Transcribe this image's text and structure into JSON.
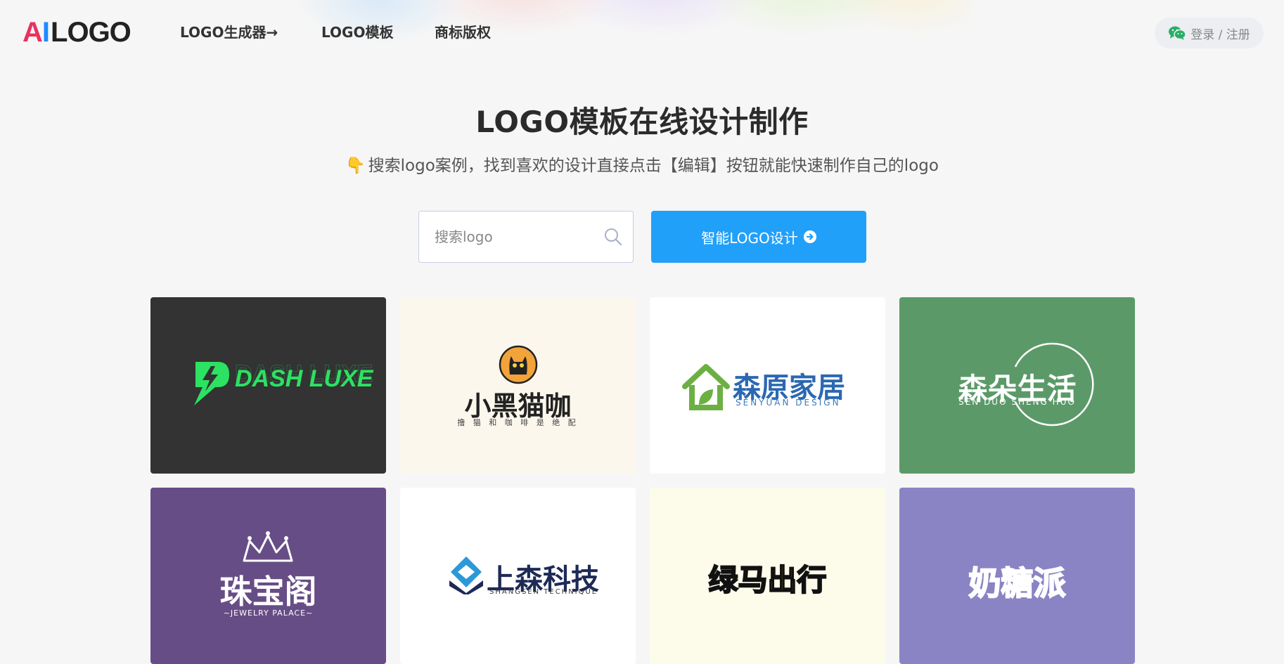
{
  "header": {
    "logo_a": "A",
    "logo_i": "I",
    "logo_rest": "LOGO",
    "nav": [
      {
        "label": "LOGO生成器→"
      },
      {
        "label": "LOGO模板"
      },
      {
        "label": "商标版权"
      }
    ],
    "login_label": "登录 / 注册"
  },
  "hero": {
    "title": "LOGO模板在线设计制作",
    "hand_icon": "👇",
    "subtitle": "搜索logo案例，找到喜欢的设计直接点击【编辑】按钮就能快速制作自己的logo"
  },
  "search": {
    "placeholder": "搜索logo",
    "value": ""
  },
  "design_button": {
    "label": "智能LOGO设计"
  },
  "cards": [
    {
      "name": "DASH LUXE",
      "bg": "#333333"
    },
    {
      "name": "小黑猫咖",
      "slogan": "撸 猫 和 咖 啡 是 绝 配",
      "bg": "#fbf7ec"
    },
    {
      "name": "森原家居",
      "en": "SENYUAN DESIGN",
      "bg": "#ffffff"
    },
    {
      "name": "森朵生活",
      "en": "SEN DUO SHENG HUO",
      "bg": "#5b9a68"
    },
    {
      "name": "珠宝阁",
      "en": "~JEWELRY PALACE~",
      "bg": "#674d86"
    },
    {
      "name": "上森科技",
      "en": "SHANGSEN TECHNIQUE",
      "bg": "#ffffff"
    },
    {
      "name_a": "绿马",
      "name_b": "出行",
      "bg": "#fdfbea"
    },
    {
      "name": "奶糖派",
      "bg": "#8a84c4"
    }
  ],
  "colors": {
    "accent_blue": "#21a0fa",
    "logo_red": "#e8335e",
    "logo_blue": "#1e8bff",
    "wechat_green": "#2aae67"
  }
}
